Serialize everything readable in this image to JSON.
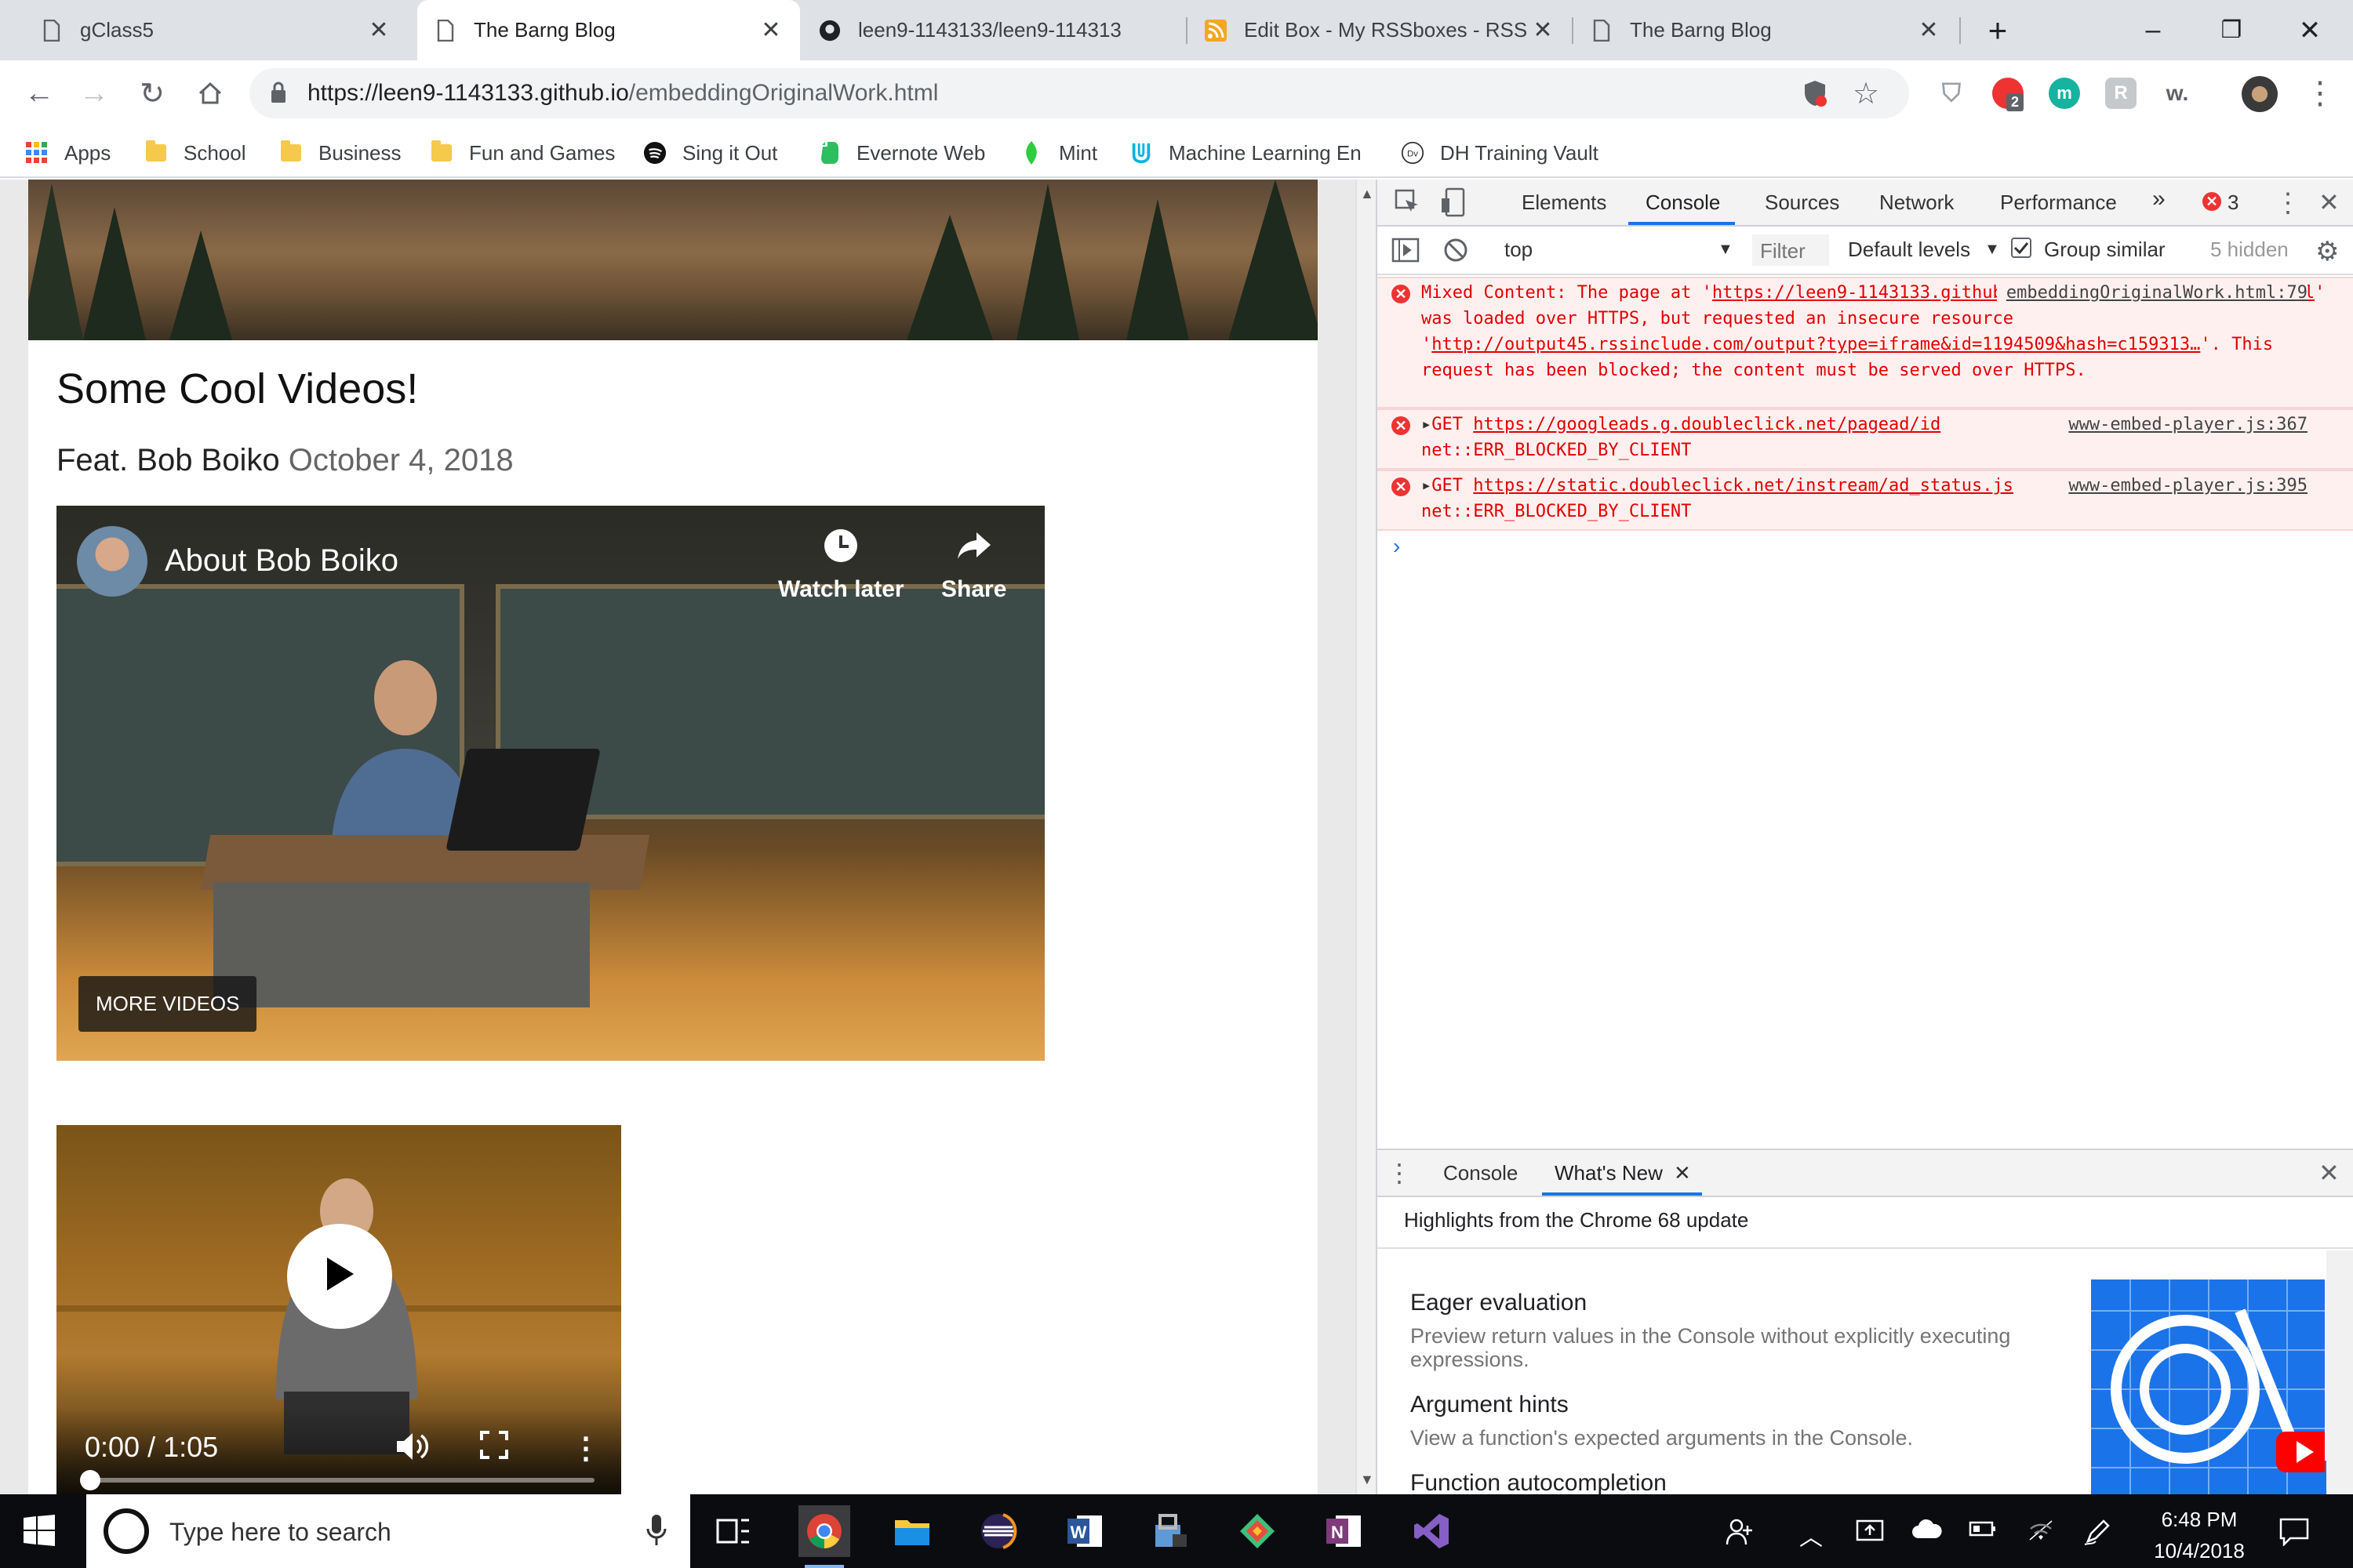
{
  "tabs": [
    {
      "title": "gClass5",
      "active": false
    },
    {
      "title": "The Barng Blog",
      "active": true
    },
    {
      "title": "leen9-1143133/leen9-114313",
      "active": false
    },
    {
      "title": "Edit Box - My RSSboxes - RSS",
      "active": false
    },
    {
      "title": "The Barng Blog",
      "active": false
    }
  ],
  "omnibox": {
    "host": "https://leen9-1143133.github.io",
    "path": "/embeddingOriginalWork.html"
  },
  "extensions": {
    "badge": "2"
  },
  "bookmarks": [
    "Apps",
    "School",
    "Business",
    "Fun and Games",
    "Sing it Out",
    "Evernote Web",
    "Mint",
    "Machine Learning En",
    "DH Training Vault"
  ],
  "page": {
    "title": "Some Cool Videos!",
    "author": "Feat. Bob Boiko",
    "date": "October 4, 2018",
    "video1": {
      "title": "About Bob Boiko",
      "watch_later": "Watch later",
      "share": "Share",
      "more": "MORE VIDEOS"
    },
    "video2": {
      "time": "0:00 / 1:05",
      "progress": 0.0
    }
  },
  "devtools": {
    "tabs": [
      "Elements",
      "Console",
      "Sources",
      "Network",
      "Performance"
    ],
    "active_tab": "Console",
    "error_count": "3",
    "context": "top",
    "filter_placeholder": "Filter",
    "levels": "Default levels",
    "group_similar": "Group similar",
    "hidden": "5 hidden",
    "messages": {
      "m1_a": "Mixed Content: The page at '",
      "m1_link1": "https://leen9-1143133.github.io/embeddingOriginalWork.html",
      "m1_b": "' was loaded over HTTPS, but requested an insecure resource '",
      "m1_link2": "http://output45.rssinclude.com/output?type=iframe&id=1194509&hash=c159313…",
      "m1_c": "'. This request has been blocked; the content must be served over HTTPS.",
      "m1_src": "embeddingOriginalWork.html:79",
      "m2_method": "GET",
      "m2_url": "https://googleads.g.doubleclick.net/pagead/id",
      "m2_err": "net::ERR_BLOCKED_BY_CLIENT",
      "m2_src": "www-embed-player.js:367",
      "m3_method": "GET",
      "m3_url": "https://static.doubleclick.net/instream/ad_status.js",
      "m3_err": "net::ERR_BLOCKED_BY_CLIENT",
      "m3_src": "www-embed-player.js:395"
    },
    "drawer": {
      "tab_console": "Console",
      "tab_whatsnew": "What's New",
      "heading": "Highlights from the Chrome 68 update",
      "features": [
        {
          "title": "Eager evaluation",
          "desc": "Preview return values in the Console without explicitly executing expressions."
        },
        {
          "title": "Argument hints",
          "desc": "View a function's expected arguments in the Console."
        },
        {
          "title": "Function autocompletion",
          "desc": ""
        }
      ]
    }
  },
  "taskbar": {
    "search": "Type here to search",
    "time": "6:48 PM",
    "date": "10/4/2018"
  },
  "colors": {
    "error": "#e30000",
    "accent": "#1a73e8",
    "tabbar": "#dee1e6"
  }
}
